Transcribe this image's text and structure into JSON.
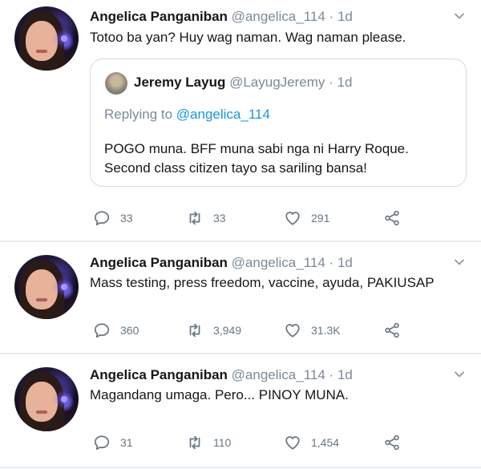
{
  "tweets": [
    {
      "name": "Angelica Panganiban",
      "handle": "@angelica_114",
      "dot": "·",
      "time": "1d",
      "text": "Totoo ba yan? Huy wag naman. Wag naman please.",
      "quote": {
        "name": "Jeremy Layug",
        "handle": "@LayugJeremy",
        "dot": "·",
        "time": "1d",
        "replying_prefix": "Replying to",
        "replying_to": "@angelica_114",
        "line1": "POGO muna. BFF muna sabi nga ni Harry Roque.",
        "line2": "Second class citizen tayo sa sariling bansa!"
      },
      "replies": "33",
      "retweets": "33",
      "likes": "291"
    },
    {
      "name": "Angelica Panganiban",
      "handle": "@angelica_114",
      "dot": "·",
      "time": "1d",
      "text": "Mass testing, press freedom, vaccine, ayuda, PAKIUSAP",
      "replies": "360",
      "retweets": "3,949",
      "likes": "31.3K"
    },
    {
      "name": "Angelica Panganiban",
      "handle": "@angelica_114",
      "dot": "·",
      "time": "1d",
      "text": "Magandang umaga. Pero... PINOY MUNA.",
      "replies": "31",
      "retweets": "110",
      "likes": "1,454"
    }
  ],
  "icons": {
    "reply": "reply-icon",
    "retweet": "retweet-icon",
    "like": "heart-icon",
    "share": "share-icon",
    "more": "chevron-down-icon"
  },
  "colors": {
    "text": "#14171a",
    "muted": "#7a8a99",
    "link": "#1b95e0",
    "divider": "#e6ecf0"
  }
}
